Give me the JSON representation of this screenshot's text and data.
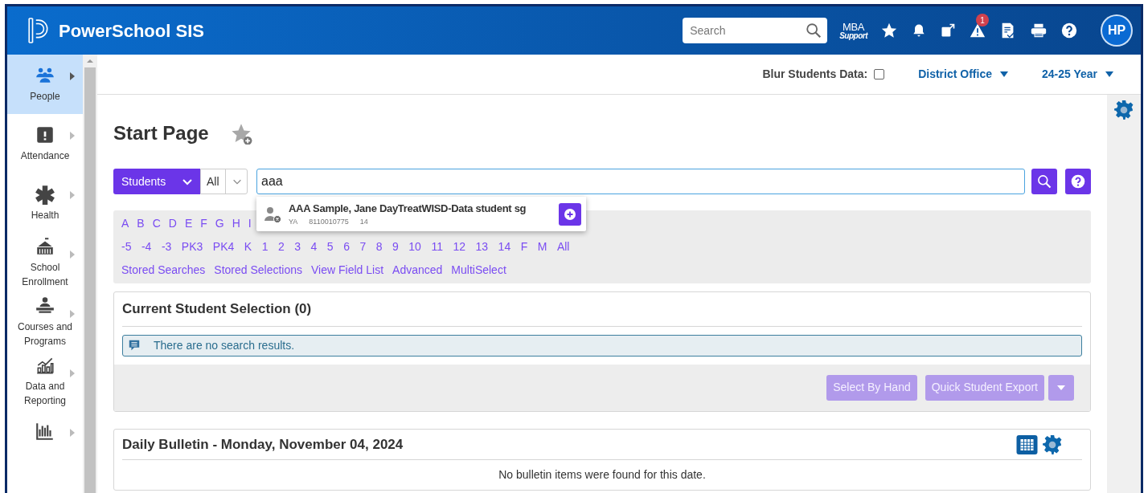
{
  "header": {
    "product": "PowerSchool SIS",
    "search": {
      "placeholder": "Search"
    },
    "support": {
      "line1": "MBA",
      "line2": "Support"
    },
    "alert_count": "1",
    "avatar": "HP"
  },
  "sidebar": {
    "items": [
      {
        "kind": "labelled",
        "label": "People",
        "selected": true
      },
      {
        "kind": "labelled",
        "label": "Attendance",
        "selected": false
      },
      {
        "kind": "labelled",
        "label": "Health",
        "selected": false
      },
      {
        "kind": "labelled",
        "label": "School Enrollment",
        "selected": false
      },
      {
        "kind": "labelled",
        "label": "Courses and Programs",
        "selected": false
      },
      {
        "kind": "labelled",
        "label": "Data and Reporting",
        "selected": false
      },
      {
        "kind": "icon_only",
        "selected": false
      }
    ]
  },
  "topbar": {
    "blur_label": "Blur Students Data:",
    "blur_checked": false,
    "school": "District Office",
    "term": "24-25 Year"
  },
  "page_title": "Start Page",
  "search": {
    "type": "Students",
    "scope": "All",
    "value": "aaa"
  },
  "suggestion": {
    "name": "AAA Sample, Jane DayTreatWISD-Data student sg",
    "detail_1": "YA",
    "detail_2": "8110010775",
    "detail_3": "14"
  },
  "letters": [
    "A",
    "B",
    "C",
    "D",
    "E",
    "F",
    "G",
    "H",
    "I"
  ],
  "grades": [
    "-5",
    "-4",
    "-3",
    "PK3",
    "PK4",
    "K",
    "1",
    "2",
    "3",
    "4",
    "5",
    "6",
    "7",
    "8",
    "9",
    "10",
    "11",
    "12",
    "13",
    "14",
    "F",
    "M",
    "All"
  ],
  "search_links": [
    "Stored Searches",
    "Stored Selections",
    "View Field List",
    "Advanced",
    "MultiSelect"
  ],
  "selection": {
    "title": "Current Student Selection (0)",
    "message": "There are no search results.",
    "buttons": [
      {
        "label": "Select By Hand",
        "disabled": true
      },
      {
        "label": "Quick Student Export",
        "disabled": true
      }
    ],
    "menu_disabled": true
  },
  "bulletin": {
    "title": "Daily Bulletin - Monday, November 04, 2024",
    "message": "No bulletin items were found for this date."
  }
}
